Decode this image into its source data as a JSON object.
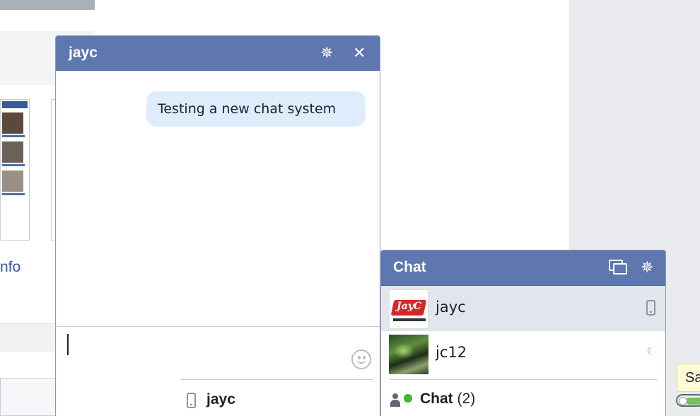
{
  "background": {
    "partial_link_text": "nfo"
  },
  "conversation": {
    "title": "jayc",
    "messages": [
      {
        "text": "Testing a new chat system",
        "direction": "outgoing"
      }
    ],
    "composer_value": "",
    "icons": {
      "settings": "gear-icon",
      "close": "close-icon",
      "emoji": "emoji-icon"
    }
  },
  "buddy_list": {
    "title": "Chat",
    "contacts": [
      {
        "name": "jayc",
        "status": "mobile",
        "status_icon": "phone-icon",
        "selected": true
      },
      {
        "name": "jc12",
        "status": "idle",
        "status_icon": "moon-icon",
        "selected": false
      }
    ]
  },
  "bottom_bar": {
    "tab_label": "jayc",
    "chat_label": "Chat",
    "chat_count": "(2)"
  },
  "tooltip": {
    "partial_text": "Sa"
  },
  "colors": {
    "header": "#5e77af",
    "bubble": "#dfecfb",
    "selected_row": "#e2e5ec",
    "online": "#42b72a",
    "link": "#365899"
  }
}
